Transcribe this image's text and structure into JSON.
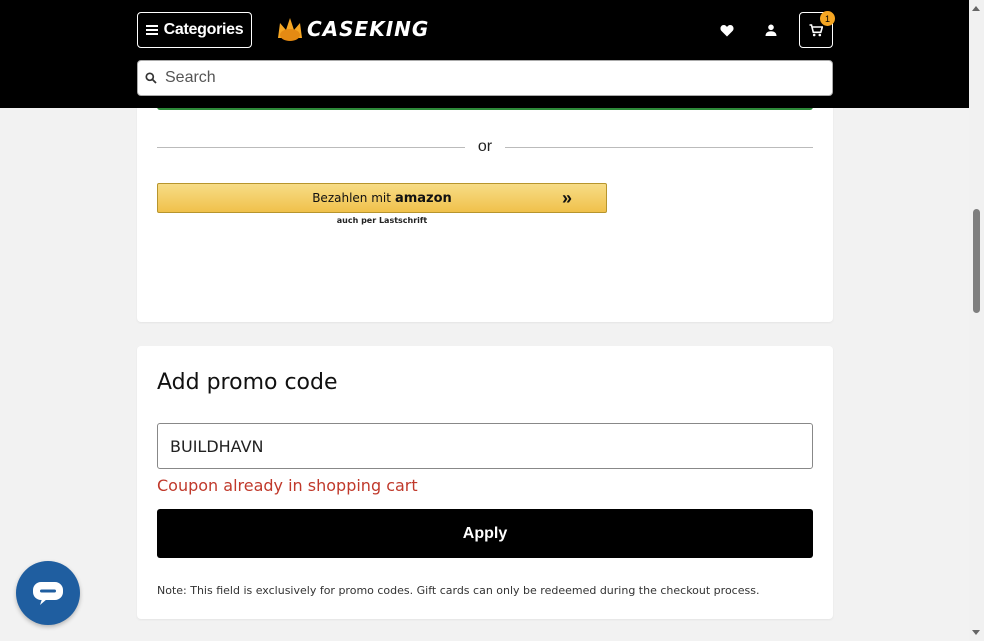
{
  "header": {
    "categories_label": "Categories",
    "logo_text": "CASEKING",
    "cart_count": "1",
    "search_placeholder": "Search",
    "search_value": ""
  },
  "payment": {
    "or_label": "or",
    "amazon_pay_prefix": "Bezahlen mit",
    "amazon_brand": "amazon",
    "amazon_sub": "auch per Lastschrift"
  },
  "promo": {
    "title": "Add promo code",
    "code_value": "BUILDHAVN",
    "error_message": "Coupon already in shopping cart",
    "apply_label": "Apply",
    "note": "Note: This field is exclusively for promo codes. Gift cards can only be redeemed during the checkout process."
  },
  "colors": {
    "header_bg": "#000000",
    "accent_green": "#2e8b3a",
    "error_red": "#c0392b",
    "chat_blue": "#1f5ea0",
    "cart_badge": "#f5a623",
    "amazon_yellow": "#f0c14b"
  },
  "icons": {
    "menu": "hamburger-icon",
    "logo": "crown-icon",
    "wishlist": "heart-icon",
    "account": "user-icon",
    "cart": "cart-icon",
    "search": "search-icon",
    "chat": "chat-icon"
  }
}
